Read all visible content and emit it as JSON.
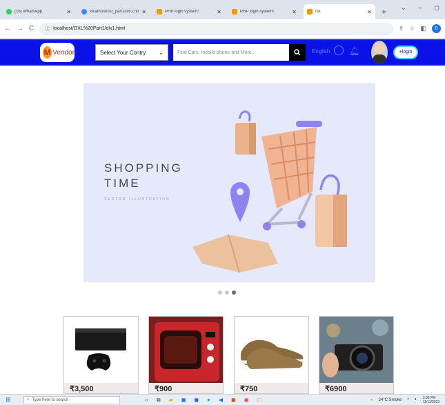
{
  "browser": {
    "tabs": [
      {
        "title": "(16) WhatsApp",
        "color": "#25d366"
      },
      {
        "title": "localhost/ost_part1/olx1.html - ...",
        "color": "#4285f4"
      },
      {
        "title": "PHP login system!",
        "color": "#f29900"
      },
      {
        "title": "PHP login system!",
        "color": "#f29900"
      },
      {
        "title": "olx",
        "color": "#f29900"
      }
    ],
    "url": "localhost/OXL%20Part1/olx1.html",
    "profile_initial": "0"
  },
  "nav": {
    "logo_letter": "M",
    "logo_text": "Vendor",
    "country_placeholder": "Select Your Contry",
    "search_placeholder": "Find Cars, mobile phone and More...",
    "language": "English",
    "login": "+login"
  },
  "hero": {
    "line1": "SHOPPING",
    "line2": "TIME",
    "subtitle": "VECTOR ILLUSTRATION"
  },
  "carousel": {
    "slides": 3,
    "active": 2
  },
  "products": [
    {
      "name": "Xbox console",
      "price": "₹3,500"
    },
    {
      "name": "Microwave oven",
      "price": "₹900"
    },
    {
      "name": "Shoes",
      "price": "₹750"
    },
    {
      "name": "Camera",
      "price": "₹6900"
    }
  ],
  "taskbar": {
    "search_placeholder": "Type here to search",
    "weather": "34°C Smoke",
    "time": "3:05 PM",
    "date": "11/11/2023"
  },
  "colors": {
    "nav_bg": "#0a12e8",
    "hero_bg": "#e6e9fb"
  }
}
